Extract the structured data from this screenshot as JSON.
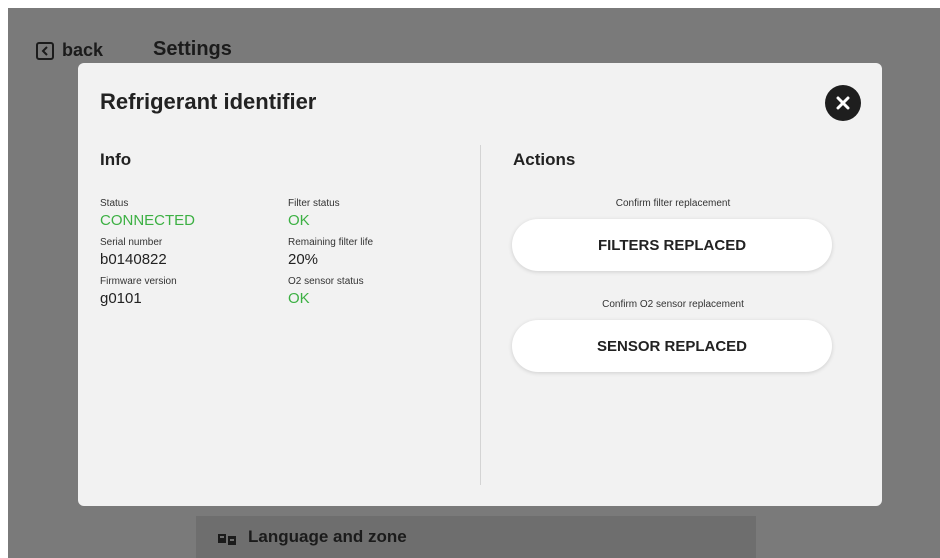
{
  "background": {
    "back_label": "back",
    "title": "Settings",
    "language_row_label": "Language and zone"
  },
  "modal": {
    "title": "Refrigerant identifier",
    "close_icon": "close-icon",
    "info": {
      "heading": "Info",
      "left": [
        {
          "label": "Status",
          "value": "CONNECTED",
          "color": "#3cb043"
        },
        {
          "label": "Serial number",
          "value": "b0140822",
          "color": "#222222"
        },
        {
          "label": "Firmware version",
          "value": "g0101",
          "color": "#222222"
        }
      ],
      "right": [
        {
          "label": "Filter status",
          "value": "OK",
          "color": "#3cb043"
        },
        {
          "label": "Remaining filter life",
          "value": "20%",
          "color": "#222222"
        },
        {
          "label": "O2 sensor status",
          "value": "OK",
          "color": "#3cb043"
        }
      ]
    },
    "actions": {
      "heading": "Actions",
      "filter_label": "Confirm filter replacement",
      "filter_button": "FILTERS REPLACED",
      "sensor_label": "Confirm O2 sensor replacement",
      "sensor_button": "SENSOR REPLACED"
    }
  }
}
